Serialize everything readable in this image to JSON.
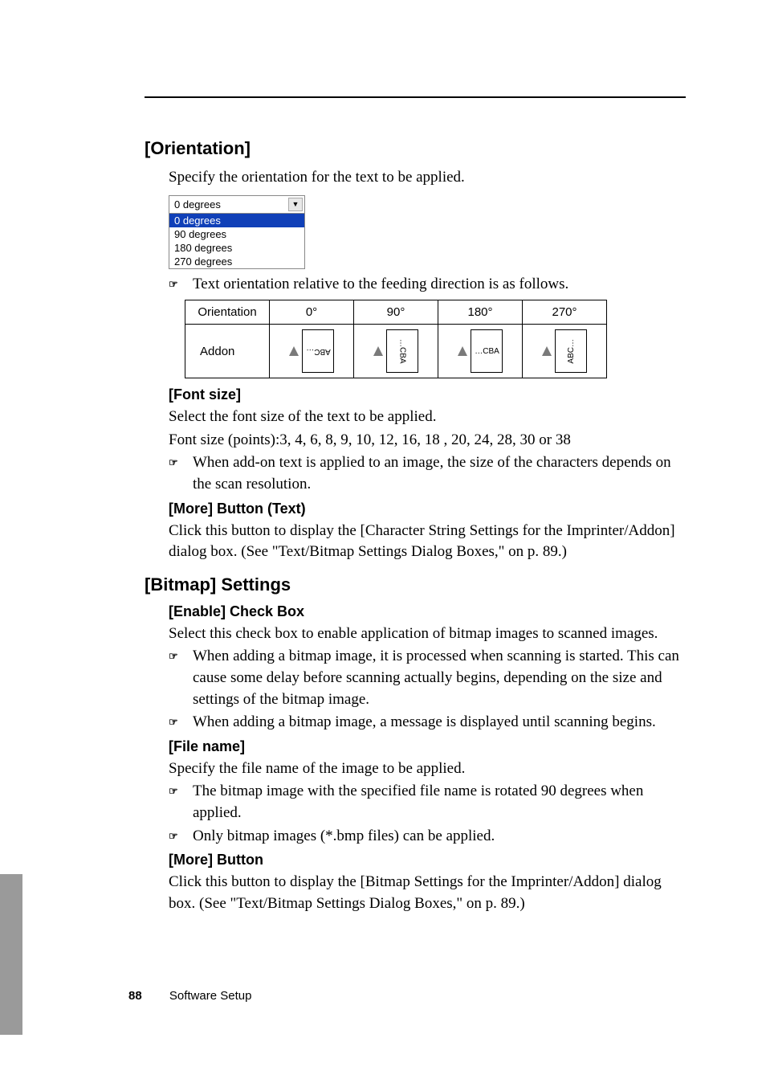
{
  "sections": {
    "orientation": {
      "heading": "[Orientation]",
      "intro": "Specify the orientation for the text to be applied.",
      "dropdown": {
        "selected": "0 degrees",
        "options": [
          "0 degrees",
          "90 degrees",
          "180 degrees",
          "270 degrees"
        ]
      },
      "note": "Text orientation relative to the feeding direction is as follows.",
      "table": {
        "header": [
          "Orientation",
          "0°",
          "90°",
          "180°",
          "270°"
        ],
        "rowLabel": "Addon",
        "cells": [
          "ABC…",
          "…CBA",
          "…CBA",
          "ABC…"
        ]
      }
    },
    "fontsize": {
      "heading": "[Font size]",
      "line1": "Select the font size of the text to be applied.",
      "line2": "Font size (points):3, 4, 6, 8, 9, 10, 12, 16, 18 , 20, 24, 28, 30 or 38",
      "note": "When add-on text is applied to an image, the size of the characters depends on the scan resolution."
    },
    "moreText": {
      "heading": "[More] Button (Text)",
      "body": "Click this button to display the [Character String Settings for the Imprinter/Addon] dialog box. (See \"Text/Bitmap Settings Dialog Boxes,\" on p. 89.)"
    },
    "bitmap": {
      "heading": "[Bitmap] Settings",
      "enable": {
        "heading": "[Enable] Check Box",
        "body": "Select this check box to enable application of bitmap images to scanned images.",
        "note1": "When adding a bitmap image, it is processed when scanning is started. This can cause some delay before scanning actually begins, depending on the size and settings of the bitmap image.",
        "note2": "When adding a bitmap image, a message is displayed until scanning begins."
      },
      "filename": {
        "heading": "[File name]",
        "body": "Specify the file name of the image to be applied.",
        "note1": "The bitmap image with the specified file name is rotated 90 degrees when applied.",
        "note2": "Only bitmap images (*.bmp files) can be applied."
      },
      "moreBtn": {
        "heading": "[More] Button",
        "body": "Click this button to display the [Bitmap Settings for the Imprinter/Addon] dialog box. (See \"Text/Bitmap Settings Dialog Boxes,\" on p. 89.)"
      }
    }
  },
  "footer": {
    "page": "88",
    "title": "Software Setup"
  },
  "noteGlyph": "☞"
}
